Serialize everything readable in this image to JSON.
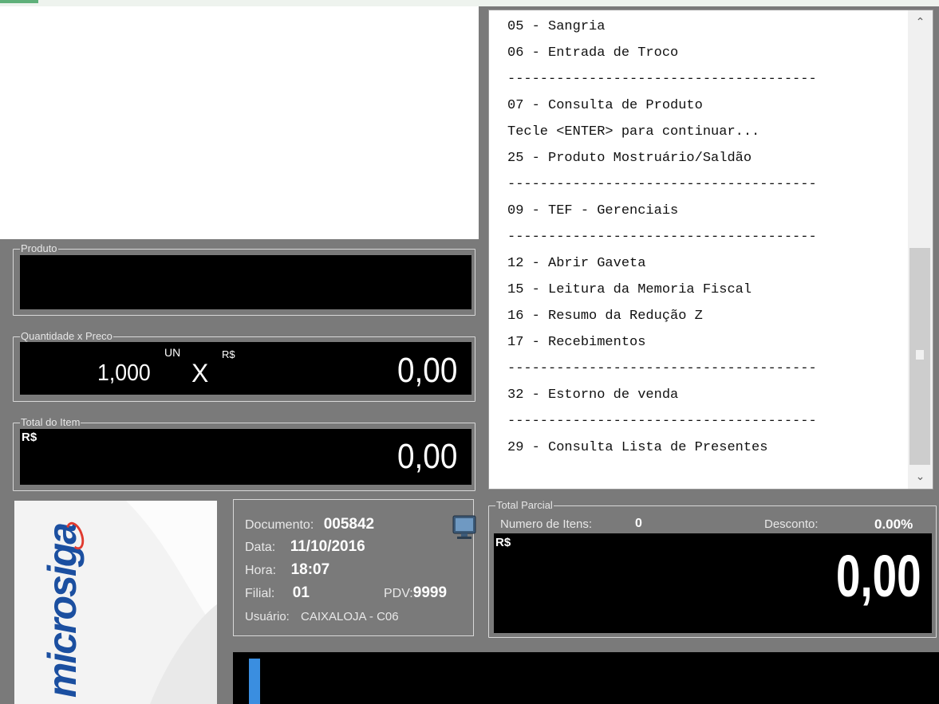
{
  "produto": {
    "legend": "Produto"
  },
  "qtd_preco": {
    "legend": "Quantidade x Preco",
    "quantity": "1,000",
    "unit": "UN",
    "x_symbol": "X",
    "currency": "R$",
    "price": "0,00"
  },
  "total_item": {
    "legend": "Total do Item",
    "currency": "R$",
    "value": "0,00"
  },
  "menu": {
    "lines": [
      "05 - Sangria",
      "06 - Entrada de Troco",
      "--------------------------------------",
      "07 - Consulta de Produto",
      "Tecle <ENTER> para continuar...",
      "25 - Produto Mostruário/Saldão",
      "--------------------------------------",
      "09 - TEF - Gerenciais",
      "--------------------------------------",
      "12 - Abrir Gaveta",
      "15 - Leitura da Memoria Fiscal",
      "16 - Resumo da Redução Z",
      "17 - Recebimentos",
      "--------------------------------------",
      "32 - Estorno de venda",
      "--------------------------------------",
      "29 - Consulta Lista de Presentes"
    ],
    "scroll_up_glyph": "^",
    "scroll_down_glyph": "v"
  },
  "logo": {
    "text": "microsiga",
    "color": "#1b4fa0",
    "accent_color": "#e03a2f"
  },
  "doc": {
    "documento_label": "Documento:",
    "documento_value": "005842",
    "data_label": "Data:",
    "data_value": "11/10/2016",
    "hora_label": "Hora:",
    "hora_value": "18:07",
    "filial_label": "Filial:",
    "filial_value": "01",
    "pdv_label": "PDV:",
    "pdv_value": "9999",
    "usuario_label": "Usuário:",
    "usuario_value": "CAIXALOJA - C06",
    "icon": "monitor-icon"
  },
  "total_parcial": {
    "legend": "Total Parcial",
    "itens_label": "Numero de Itens:",
    "itens_value": "0",
    "desconto_label": "Desconto:",
    "desconto_value": "0.00%",
    "currency": "R$",
    "value": "0,00"
  },
  "colors": {
    "background": "#7a7a7a",
    "accent_blue": "#3a8ee0"
  }
}
